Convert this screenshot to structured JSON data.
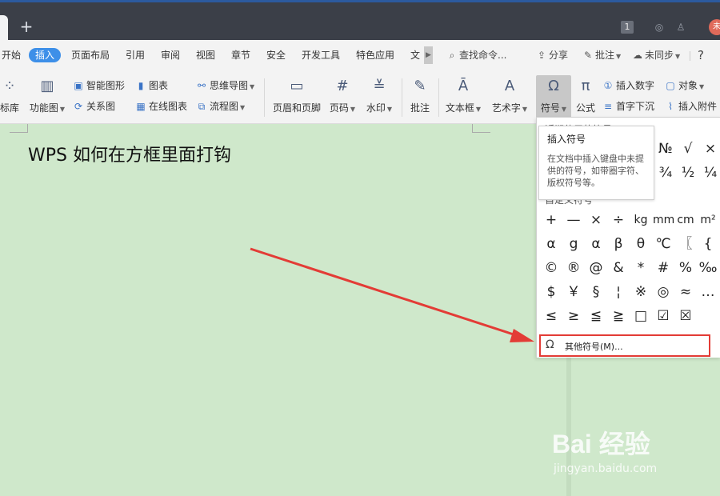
{
  "tabs": {
    "new_tab": "+"
  },
  "titlebar": {
    "badge": "1",
    "avatar_text": "未"
  },
  "menu": {
    "items": [
      "开始",
      "插入",
      "页面布局",
      "引用",
      "审阅",
      "视图",
      "章节",
      "安全",
      "开发工具",
      "特色应用",
      "文"
    ],
    "active": "插入",
    "search": "查找命令...",
    "share": "分享",
    "comment": "批注",
    "sync": "未同步",
    "help": "?"
  },
  "ribbon": {
    "shape_lib": "标库",
    "function_chart": "功能图",
    "smart_shape": "智能图形",
    "chart": "图表",
    "mind_map": "思维导图",
    "relation_chart": "关系图",
    "online_chart": "在线图表",
    "flowchart": "流程图",
    "header_footer": "页眉和页脚",
    "page_number": "页码",
    "watermark": "水印",
    "comment": "批注",
    "text_box": "文本框",
    "word_art": "艺术字",
    "symbol": "符号",
    "formula": "公式",
    "insert_number": "插入数字",
    "object": "对象",
    "drop_cap": "首字下沉",
    "attachment": "插入附件"
  },
  "document": {
    "title": "WPS 如何在方框里面打钩"
  },
  "tooltip": {
    "title": "插入符号",
    "body": "在文档中插入键盘中未提供的符号，如带圈字符、版权符号等。"
  },
  "symbol_menu": {
    "recent_header": "近期使用的符号",
    "custom_header": "自定义符号",
    "recent": [
      "№",
      "√",
      "×",
      "¾",
      "½",
      "¼"
    ],
    "grid": [
      [
        "+",
        "—",
        "×",
        "÷",
        "kg",
        "mm",
        "cm",
        "m²"
      ],
      [
        "α",
        "g",
        "α",
        "β",
        "θ",
        "℃",
        "〖",
        "{"
      ],
      [
        "©",
        "®",
        "@",
        "&",
        "*",
        "#",
        "%",
        "‰"
      ],
      [
        "$",
        "￥",
        "§",
        "¦",
        "※",
        "◎",
        "≈",
        "…"
      ],
      [
        "≤",
        "≥",
        "≦",
        "≧",
        "□",
        "☑",
        "☒",
        ""
      ]
    ],
    "more": "其他符号(M)..."
  },
  "watermark": {
    "logo": "Bai 经验",
    "url": "jingyan.baidu.com"
  },
  "colors": {
    "active_tab": "#3d8fe8",
    "highlight_border": "#e33c36",
    "arrow": "#e33c36",
    "page_bg": "#cfe8cb"
  }
}
